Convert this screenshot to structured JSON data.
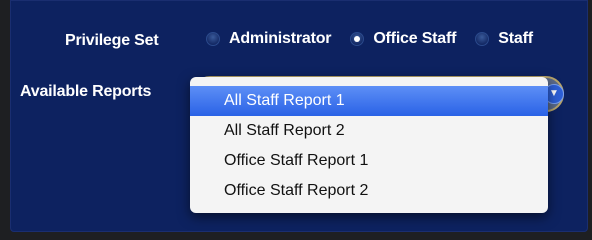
{
  "privilege_set": {
    "label": "Privilege Set",
    "options": [
      "Administrator",
      "Office Staff",
      "Staff"
    ],
    "selected": "Office Staff"
  },
  "available_reports": {
    "label": "Available Reports",
    "options": [
      "All Staff Report 1",
      "All Staff Report 2",
      "Office Staff Report 1",
      "Office Staff Report 2"
    ],
    "highlighted": "All Staff Report 1"
  },
  "colors": {
    "panel": "#0d2260",
    "highlight": "#2a62e6"
  }
}
